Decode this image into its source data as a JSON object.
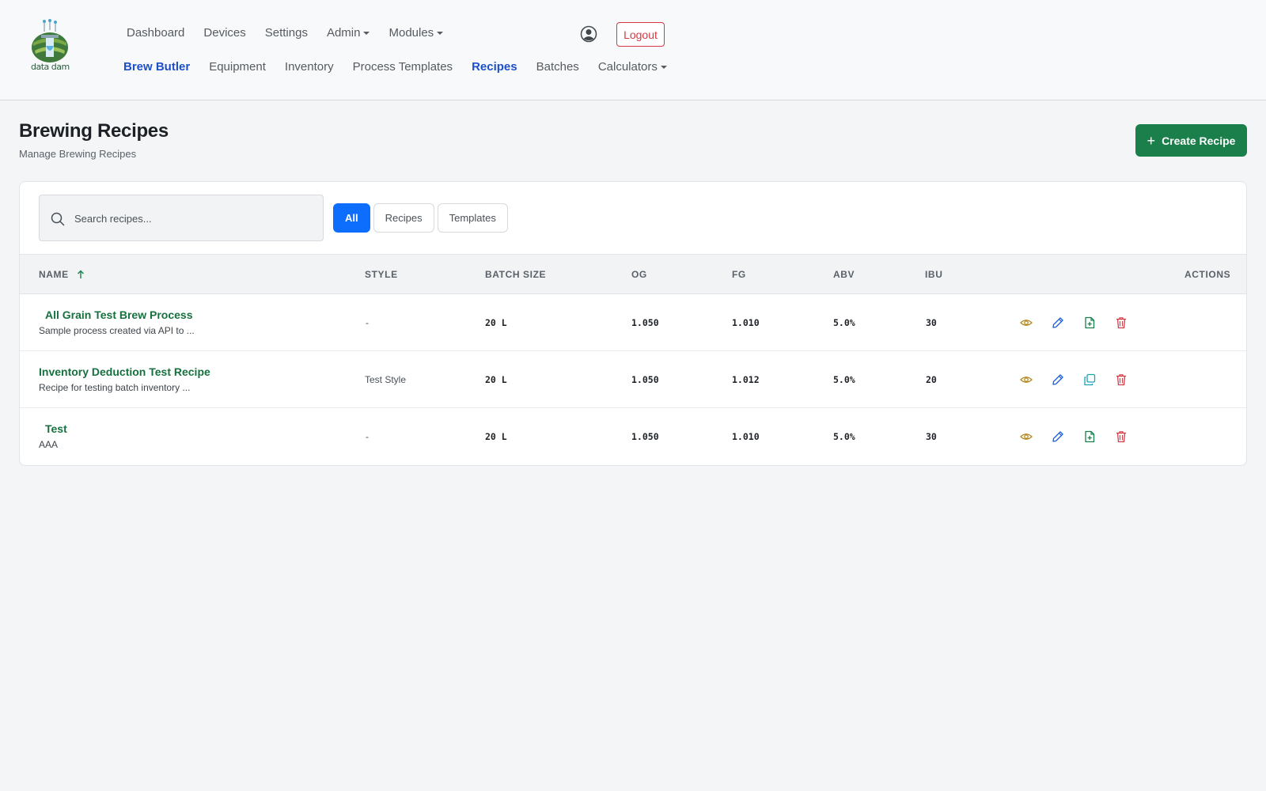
{
  "header": {
    "logo_text": "data dam",
    "nav_primary": [
      {
        "label": "Dashboard"
      },
      {
        "label": "Devices"
      },
      {
        "label": "Settings"
      },
      {
        "label": "Admin",
        "dropdown": true
      },
      {
        "label": "Modules",
        "dropdown": true
      }
    ],
    "nav_secondary": [
      {
        "label": "Brew Butler"
      },
      {
        "label": "Equipment"
      },
      {
        "label": "Inventory"
      },
      {
        "label": "Process Templates"
      },
      {
        "label": "Recipes",
        "active": true
      },
      {
        "label": "Batches"
      },
      {
        "label": "Calculators",
        "dropdown": true
      }
    ],
    "logout_label": "Logout"
  },
  "page": {
    "title": "Brewing Recipes",
    "subtitle": "Manage Brewing Recipes",
    "create_label": "Create Recipe"
  },
  "search": {
    "placeholder": "Search recipes...",
    "value": ""
  },
  "filters": [
    {
      "label": "All",
      "active": true
    },
    {
      "label": "Recipes"
    },
    {
      "label": "Templates"
    }
  ],
  "table": {
    "columns": [
      "NAME",
      "STYLE",
      "BATCH SIZE",
      "OG",
      "FG",
      "ABV",
      "IBU",
      "ACTIONS"
    ],
    "rows": [
      {
        "name": "All Grain Test Brew Process",
        "description": "Sample process created via API to ...",
        "style": "-",
        "batch_size": "20 L",
        "og": "1.050",
        "fg": "1.010",
        "abv": "5.0%",
        "ibu": "30",
        "third_action": "create-from-template-icon"
      },
      {
        "name": "Inventory Deduction Test Recipe",
        "description": "Recipe for testing batch inventory ...",
        "style": "Test Style",
        "batch_size": "20 L",
        "og": "1.050",
        "fg": "1.012",
        "abv": "5.0%",
        "ibu": "20",
        "third_action": "copy-icon"
      },
      {
        "name": "Test",
        "description": "AAA",
        "style": "-",
        "batch_size": "20 L",
        "og": "1.050",
        "fg": "1.010",
        "abv": "5.0%",
        "ibu": "30",
        "third_action": "create-from-template-icon"
      }
    ]
  },
  "colors": {
    "primary": "#0d6efd",
    "success": "#1a7f4a",
    "danger": "#d43a46",
    "nav_active": "#1d4fc7",
    "view_icon": "#b38a1d",
    "edit_icon": "#1d5fd4",
    "copy_icon": "#19a3b4"
  }
}
